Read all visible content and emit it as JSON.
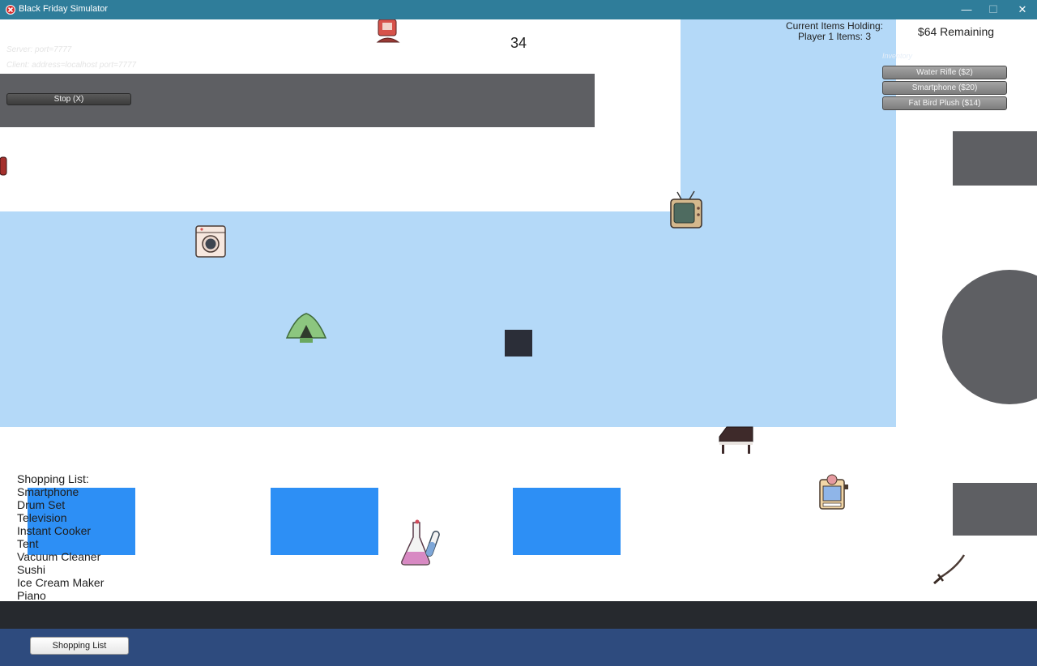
{
  "window": {
    "title": "Black Friday Simulator",
    "minimize_glyph": "—",
    "maximize_glyph": "☐",
    "close_glyph": "✕"
  },
  "hud": {
    "timer": "34",
    "holding_title": "Current Items Holding:",
    "holding_value": "Player 1 Items: 3",
    "remaining": "$64 Remaining",
    "inventory_label": "Inventory",
    "inventory": [
      "Water Rifle ($2)",
      "Smartphone ($20)",
      "Fat Bird Plush ($14)"
    ]
  },
  "network": {
    "server": "Server: port=7777",
    "client": "Client: address=localhost port=7777",
    "stop_label": "Stop (X)"
  },
  "shopping_list": {
    "title": "Shopping List:",
    "items": [
      "Smartphone",
      "Drum Set",
      "Television",
      "Instant Cooker",
      "Tent",
      "Vacuum Cleaner",
      "Sushi",
      "Ice Cream Maker",
      "Piano"
    ],
    "button_label": "Shopping List"
  },
  "items_on_map": [
    "washing-machine-icon",
    "tent-icon",
    "television-icon",
    "piano-icon",
    "chemistry-set-icon",
    "ice-cream-maker-icon",
    "katana-icon",
    "fire-extinguisher-icon",
    "player-icon"
  ],
  "colors": {
    "floor": "#b4d9f8",
    "shelf": "#2d8ff5",
    "wall": "#5e5f63",
    "titlebar": "#2f7d9a",
    "bottom_bar": "#2e4b7e"
  }
}
